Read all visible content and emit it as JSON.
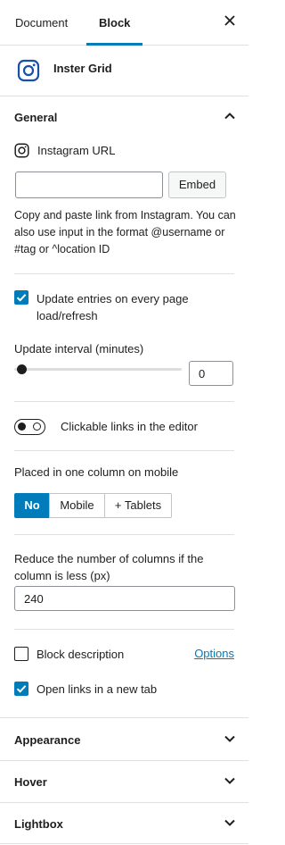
{
  "tabs": [
    {
      "label": "Document"
    },
    {
      "label": "Block"
    }
  ],
  "block": {
    "name": "Inster Grid"
  },
  "general": {
    "title": "General",
    "instagram_url": {
      "label": "Instagram URL",
      "value": "",
      "embed_label": "Embed"
    },
    "help_text": "Copy and paste link from Instagram. You can also use input in the format @username or #tag or ^location ID",
    "update_entries": {
      "label": "Update entries on every page load/refresh",
      "checked": true
    },
    "update_interval": {
      "label": "Update interval (minutes)",
      "value": "0",
      "slider_value": 0
    },
    "clickable_links": {
      "label": "Clickable links in the editor",
      "enabled": false
    },
    "mobile_column": {
      "label": "Placed in one column on mobile",
      "options": [
        "No",
        "Mobile",
        "+ Tablets"
      ],
      "selected": "No"
    },
    "reduce_columns": {
      "label": "Reduce the number of columns if the column is less (px)",
      "value": "240"
    },
    "block_description": {
      "label": "Block description",
      "checked": false,
      "options_link": "Options"
    },
    "open_new_tab": {
      "label": "Open links in a new tab",
      "checked": true
    }
  },
  "panels": [
    {
      "title": "Appearance"
    },
    {
      "title": "Hover"
    },
    {
      "title": "Lightbox"
    }
  ],
  "colors": {
    "accent": "#007cba",
    "text": "#1e1e1e",
    "border": "#e0e0e0"
  }
}
